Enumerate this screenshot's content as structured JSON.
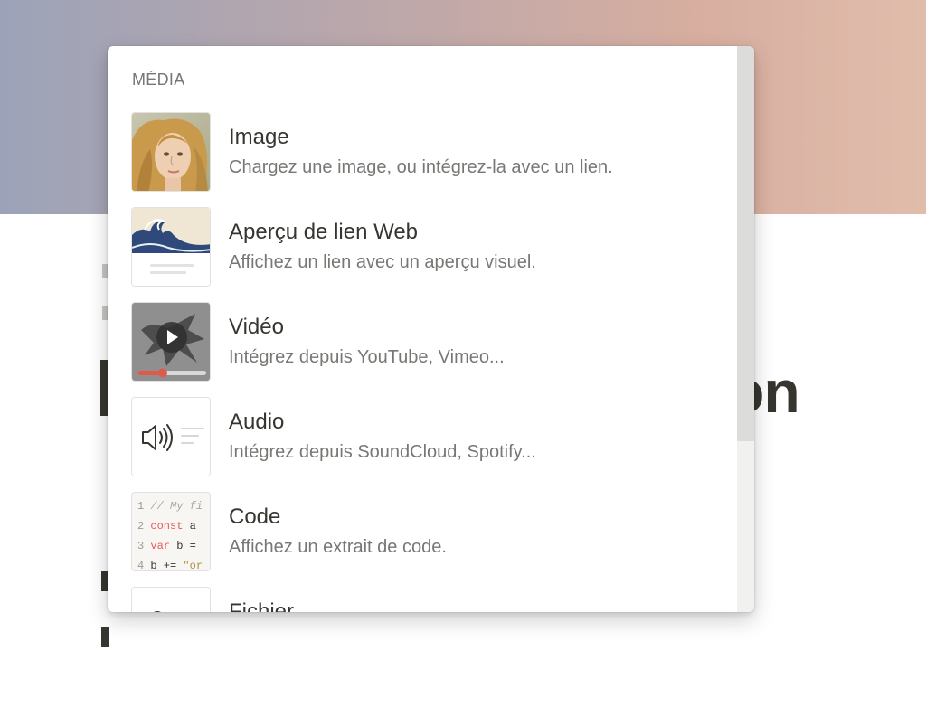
{
  "background": {
    "cover_colors": [
      "#9ca3b8",
      "#d7aea0",
      "#e1bcab"
    ],
    "title_fragment": "on"
  },
  "menu": {
    "section_label": "MÉDIA",
    "items": [
      {
        "icon": "image-thumbnail-icon",
        "title": "Image",
        "description": "Chargez une image, ou intégrez-la avec un lien."
      },
      {
        "icon": "web-bookmark-thumbnail-icon",
        "title": "Aperçu de lien Web",
        "description": "Affichez un lien avec un aperçu visuel."
      },
      {
        "icon": "video-thumbnail-icon",
        "title": "Vidéo",
        "description": "Intégrez depuis YouTube, Vimeo..."
      },
      {
        "icon": "audio-thumbnail-icon",
        "title": "Audio",
        "description": "Intégrez depuis SoundCloud, Spotify..."
      },
      {
        "icon": "code-thumbnail-icon",
        "title": "Code",
        "description": "Affichez un extrait de code.",
        "code_preview": [
          "// My fi",
          "const a",
          "var b =",
          "b += \"or"
        ]
      },
      {
        "icon": "file-thumbnail-icon",
        "title": "Fichier",
        "description": ""
      }
    ]
  },
  "colors": {
    "text_primary": "#37352f",
    "text_secondary": "#787774",
    "code_keyword": "#eb5757"
  }
}
